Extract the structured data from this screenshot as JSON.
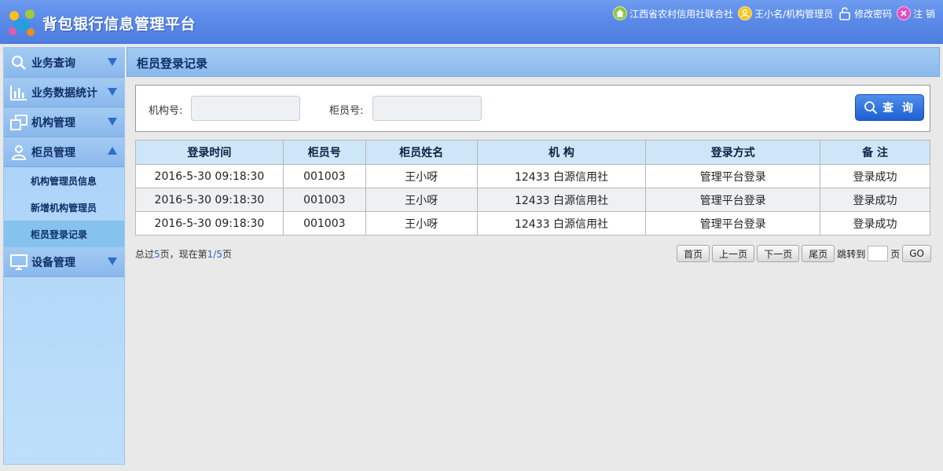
{
  "header": {
    "app_title": "背包银行信息管理平台",
    "links": [
      {
        "label": "江西省农村信用社联合社",
        "icon": "home-icon"
      },
      {
        "label": "王小名/机构管理员",
        "icon": "user-icon"
      },
      {
        "label": "修改密码",
        "icon": "lock-icon"
      },
      {
        "label": "注 销",
        "icon": "logout-icon"
      }
    ]
  },
  "sidebar": {
    "groups": [
      {
        "label": "业务查询",
        "icon": "search-icon",
        "expanded": false
      },
      {
        "label": "业务数据统计",
        "icon": "bar-chart-icon",
        "expanded": false
      },
      {
        "label": "机构管理",
        "icon": "windows-icon",
        "expanded": false
      },
      {
        "label": "柜员管理",
        "icon": "user-icon",
        "expanded": true,
        "items": [
          {
            "label": "机构管理员信息",
            "active": false
          },
          {
            "label": "新增机构管理员",
            "active": false
          },
          {
            "label": "柜员登录记录",
            "active": true
          }
        ]
      },
      {
        "label": "设备管理",
        "icon": "monitor-icon",
        "expanded": false
      }
    ]
  },
  "main": {
    "title": "柜员登录记录",
    "filters": {
      "org_label": "机构号:",
      "org_value": "",
      "teller_label": "柜员号:",
      "teller_value": ""
    },
    "query_button": "查 询",
    "table": {
      "headers": [
        "登录时间",
        "柜员号",
        "柜员姓名",
        "机 构",
        "登录方式",
        "备 注"
      ],
      "rows": [
        [
          "2016-5-30 09:18:30",
          "001003",
          "王小呀",
          "12433 白源信用社",
          "管理平台登录",
          "登录成功"
        ],
        [
          "2016-5-30 09:18:30",
          "001003",
          "王小呀",
          "12433 白源信用社",
          "管理平台登录",
          "登录成功"
        ],
        [
          "2016-5-30 09:18:30",
          "001003",
          "王小呀",
          "12433 白源信用社",
          "管理平台登录",
          "登录成功"
        ]
      ]
    },
    "pagination": {
      "text_prefix": "总过",
      "total_pages": "5",
      "text_mid": "页，现在第",
      "current_page": "1/5",
      "text_suffix": "页",
      "first": "首页",
      "prev": "上一页",
      "next": "下一页",
      "last": "尾页",
      "jump_label": "跳转到",
      "jump_value": "",
      "page_unit": "页",
      "go": "GO"
    }
  },
  "colors": {
    "header_blue": "#5b8ae8",
    "sidebar_blue": "#a3cbf3",
    "table_header": "#cde7f8",
    "accent_text": "#2d63c8"
  }
}
